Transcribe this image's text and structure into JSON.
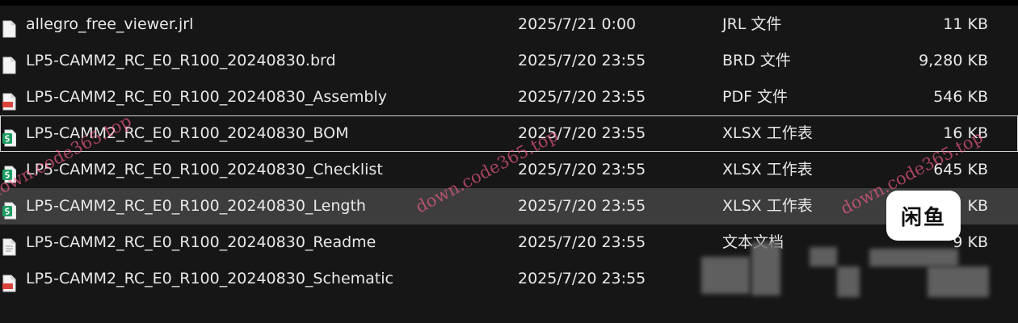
{
  "files": [
    {
      "name": "allegro_free_viewer.jrl",
      "date": "2025/7/21 0:00",
      "type": "JRL 文件",
      "size": "11 KB",
      "icon": "document-icon",
      "state": "normal"
    },
    {
      "name": "LP5-CAMM2_RC_E0_R100_20240830.brd",
      "date": "2025/7/20 23:55",
      "type": "BRD 文件",
      "size": "9,280 KB",
      "icon": "document-icon",
      "state": "normal"
    },
    {
      "name": "LP5-CAMM2_RC_E0_R100_20240830_Assembly",
      "date": "2025/7/20 23:55",
      "type": "PDF 文件",
      "size": "546 KB",
      "icon": "pdf-icon",
      "state": "normal"
    },
    {
      "name": "LP5-CAMM2_RC_E0_R100_20240830_BOM",
      "date": "2025/7/20 23:55",
      "type": "XLSX 工作表",
      "size": "16 KB",
      "icon": "spreadsheet-icon",
      "state": "focused"
    },
    {
      "name": "LP5-CAMM2_RC_E0_R100_20240830_Checklist",
      "date": "2025/7/20 23:55",
      "type": "XLSX 工作表",
      "size": "645 KB",
      "icon": "spreadsheet-icon",
      "state": "normal"
    },
    {
      "name": "LP5-CAMM2_RC_E0_R100_20240830_Length",
      "date": "2025/7/20 23:55",
      "type": "XLSX 工作表",
      "size": "KB",
      "icon": "spreadsheet-icon",
      "state": "hover"
    },
    {
      "name": "LP5-CAMM2_RC_E0_R100_20240830_Readme",
      "date": "2025/7/20 23:55",
      "type": "文本文档",
      "size": "9 KB",
      "icon": "text-file-icon",
      "state": "normal"
    },
    {
      "name": "LP5-CAMM2_RC_E0_R100_20240830_Schematic",
      "date": "2025/7/20 23:55",
      "type": "",
      "size": "",
      "icon": "pdf-icon",
      "state": "normal"
    }
  ],
  "watermarks": [
    "down.code365.top",
    "down.code365.top",
    "down.code365.top"
  ],
  "badge": {
    "text": "闲鱼"
  },
  "colors": {
    "background": "#161616",
    "row_hover": "#3d3d3d",
    "spreadsheet_green": "#1e9e63",
    "pdf_red": "#d9453b",
    "watermark": "#ff5f8c"
  }
}
